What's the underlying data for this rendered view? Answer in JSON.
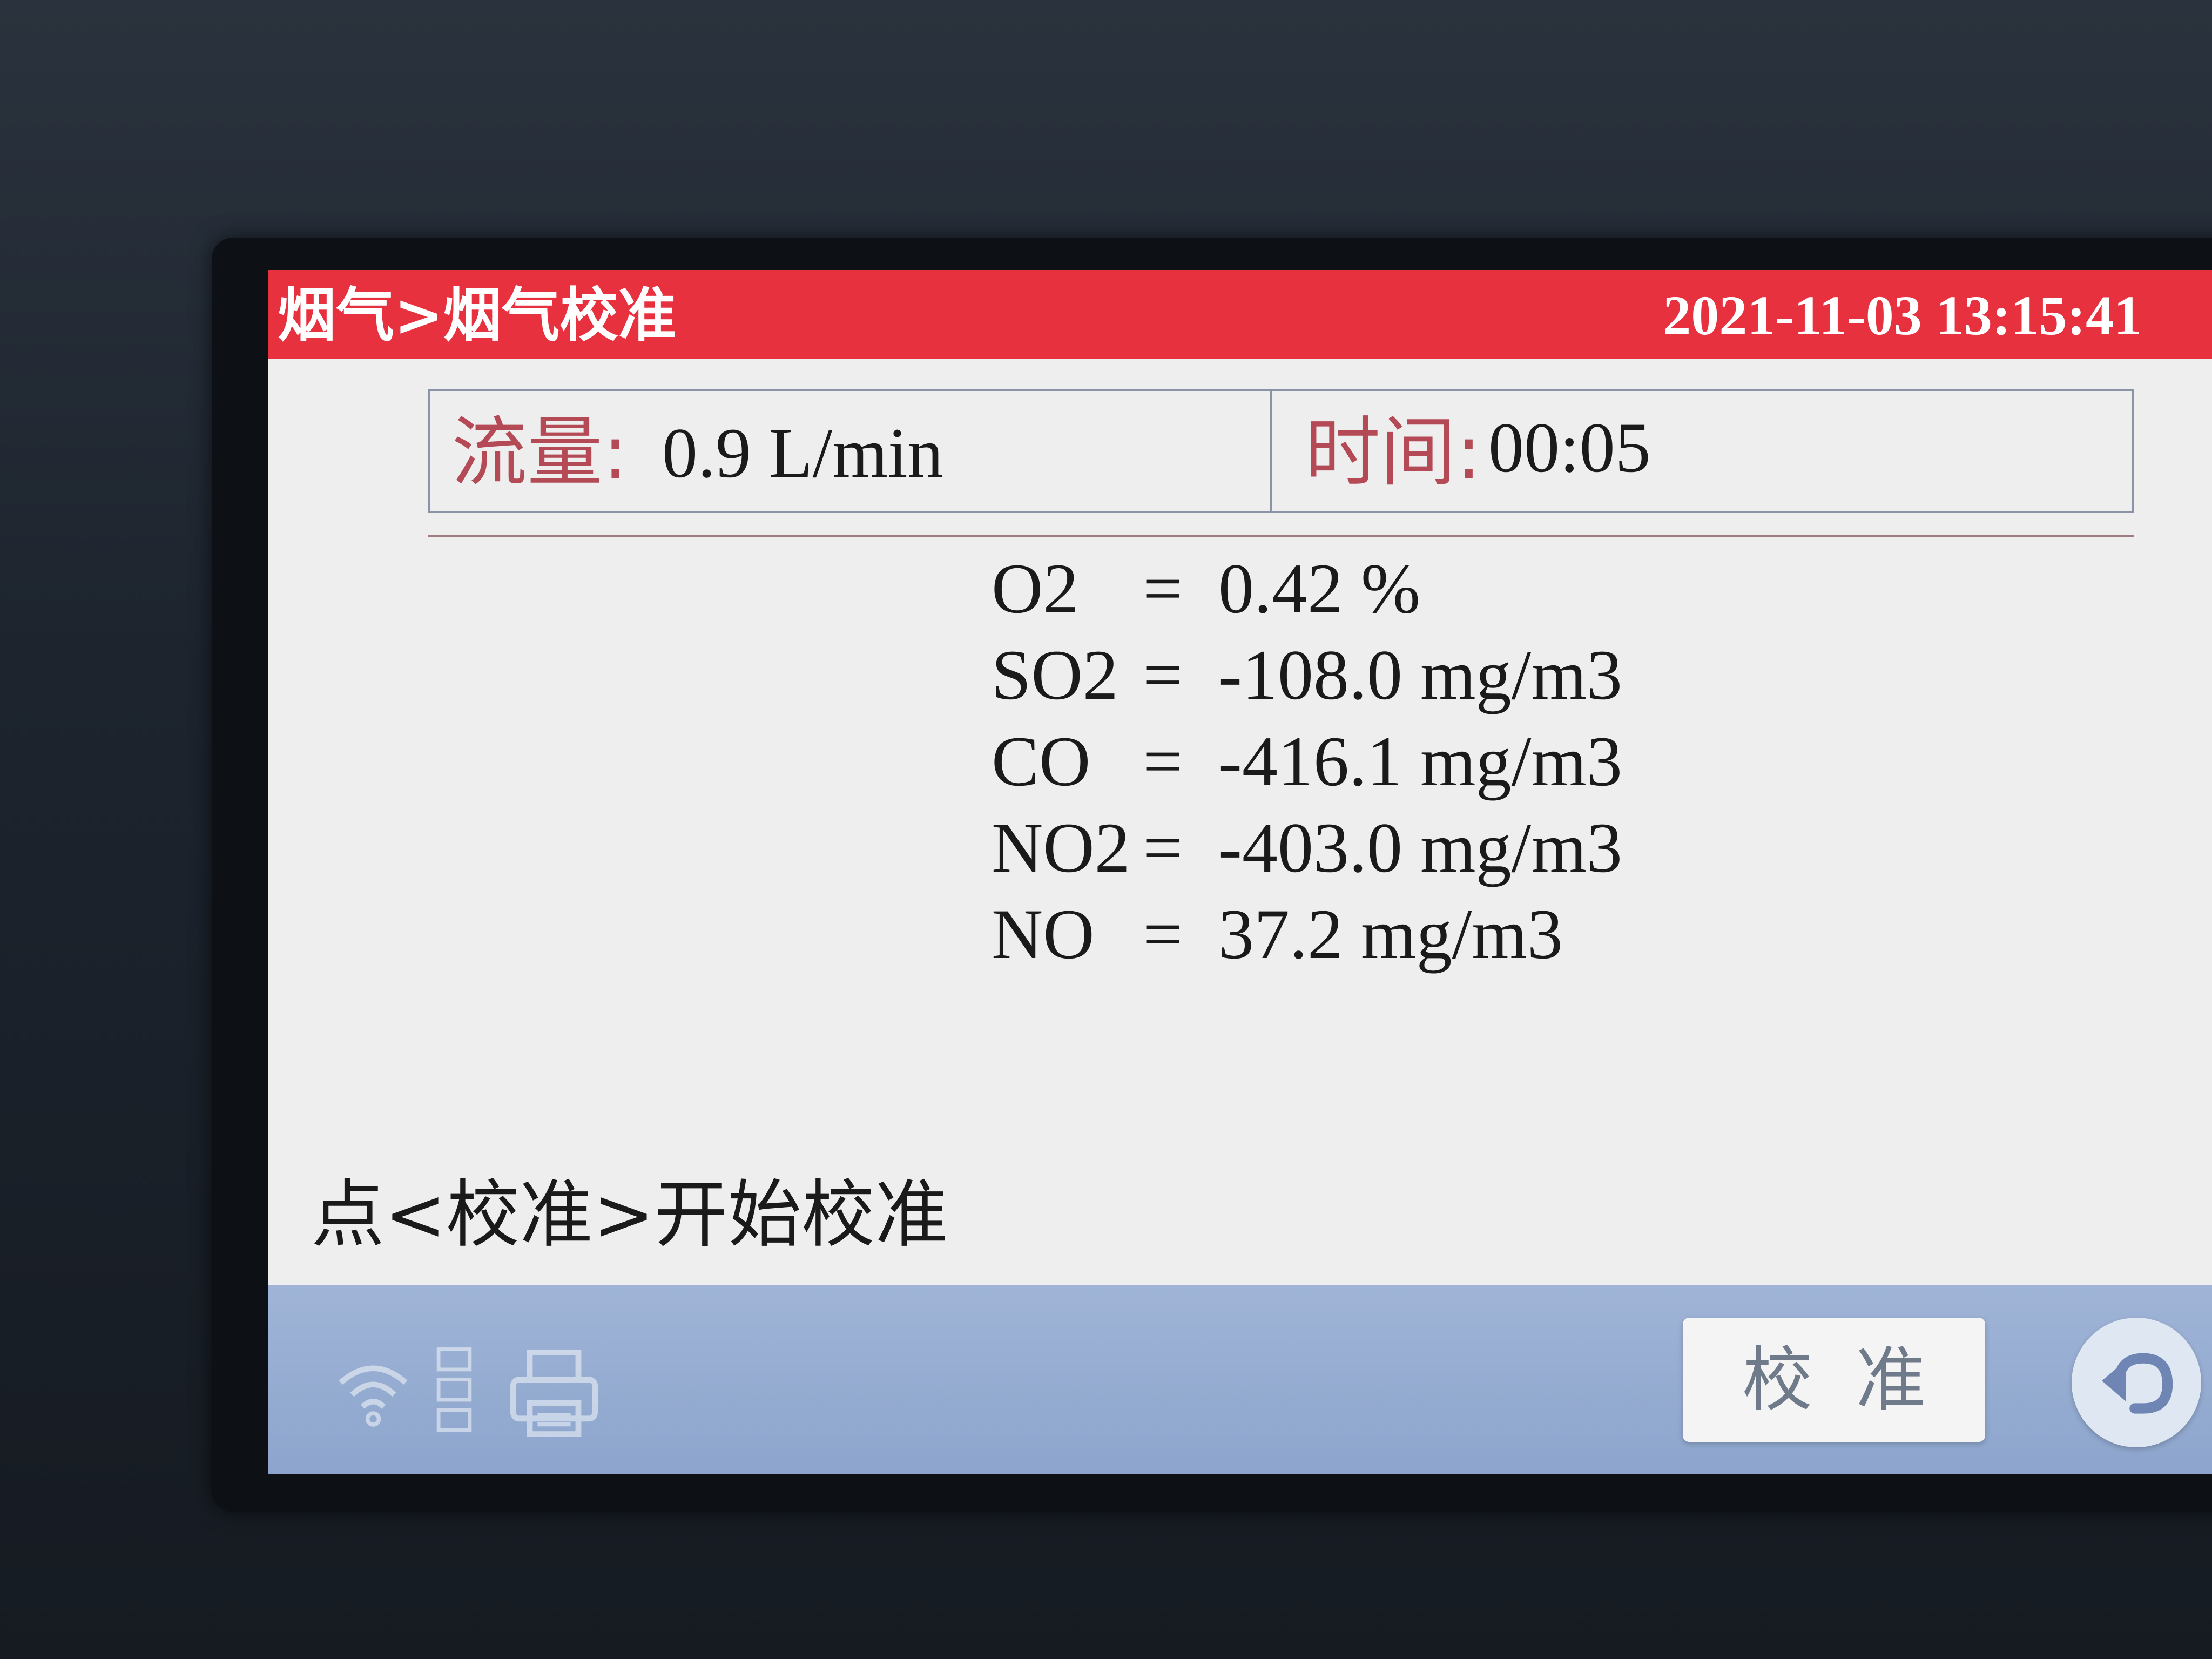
{
  "header": {
    "breadcrumb": "烟气>烟气校准",
    "datetime": "2021-11-03  13:15:41"
  },
  "info": {
    "flow_label": "流量:",
    "flow_value": "0.9  L/min",
    "time_label": "时间:",
    "time_value": "00:05"
  },
  "readings": [
    {
      "gas": "O2",
      "eq": "=",
      "value": "0.42  %"
    },
    {
      "gas": "SO2",
      "eq": "=",
      "value": "-108.0  mg/m3"
    },
    {
      "gas": "CO",
      "eq": "=",
      "value": "-416.1  mg/m3"
    },
    {
      "gas": "NO2",
      "eq": "=",
      "value": "-403.0  mg/m3"
    },
    {
      "gas": "NO",
      "eq": "=",
      "value": "37.2  mg/m3"
    }
  ],
  "hint": "点<校准>开始校准",
  "footer": {
    "calibrate_label": "校准",
    "icons": [
      "wifi-icon",
      "usb-icon",
      "printer-icon",
      "back-icon"
    ]
  },
  "colors": {
    "header_bg": "#e8313f",
    "footer_bg": "#9fb4d6",
    "label_red": "#b44a55"
  }
}
